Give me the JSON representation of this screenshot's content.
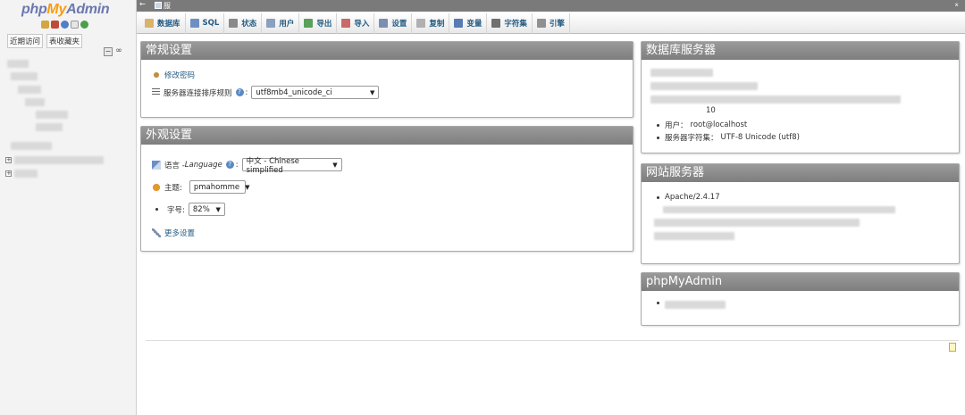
{
  "nav": {
    "logo_php": "php",
    "logo_my": "My",
    "logo_admin": "Admin",
    "tabs": [
      "近期访问",
      "表收藏夹"
    ]
  },
  "topbar": {
    "back_arrow": "←",
    "server_label": "服",
    "close": "⌅"
  },
  "menu": [
    {
      "label": "数据库",
      "icon": "database-icon",
      "color": "#d9b36a"
    },
    {
      "label": "SQL",
      "icon": "sql-icon",
      "color": "#6f8fc4"
    },
    {
      "label": "状态",
      "icon": "status-icon",
      "color": "#8a8a8a"
    },
    {
      "label": "用户",
      "icon": "users-icon",
      "color": "#8aa0c0"
    },
    {
      "label": "导出",
      "icon": "export-icon",
      "color": "#5aa05a"
    },
    {
      "label": "导入",
      "icon": "import-icon",
      "color": "#c86a6a"
    },
    {
      "label": "设置",
      "icon": "wrench-icon",
      "color": "#7c8fb0"
    },
    {
      "label": "复制",
      "icon": "replication-icon",
      "color": "#b0b0b0"
    },
    {
      "label": "变量",
      "icon": "variables-icon",
      "color": "#5a7ab5"
    },
    {
      "label": "字符集",
      "icon": "charset-icon",
      "color": "#707070"
    },
    {
      "label": "引擎",
      "icon": "engine-icon",
      "color": "#909090"
    }
  ],
  "general": {
    "title": "常规设置",
    "change_password": "修改密码",
    "collation_label": "服务器连接排序规则",
    "collation_value": "utf8mb4_unicode_ci"
  },
  "appearance": {
    "title": "外观设置",
    "language_label": "语言 - ",
    "language_label_en": "Language",
    "language_value": "中文 - Chinese simplified",
    "theme_label": "主题:",
    "theme_value": "pmahomme",
    "fontsize_label": "字号:",
    "fontsize_value": "82%",
    "more_settings": "更多设置"
  },
  "db_server": {
    "title": "数据库服务器",
    "partial": "10",
    "user_label": "用户：",
    "user_value": "root@localhost",
    "charset_label": "服务器字符集：",
    "charset_value": "UTF-8 Unicode (utf8)"
  },
  "web_server": {
    "title": "网站服务器",
    "apache": "Apache/2.4.17"
  },
  "pma": {
    "title": "phpMyAdmin"
  },
  "colors": {
    "link": "#235a81",
    "panel_header": "#8a8a8a",
    "logo_blue": "#6c78af",
    "logo_orange": "#f89c0e"
  }
}
